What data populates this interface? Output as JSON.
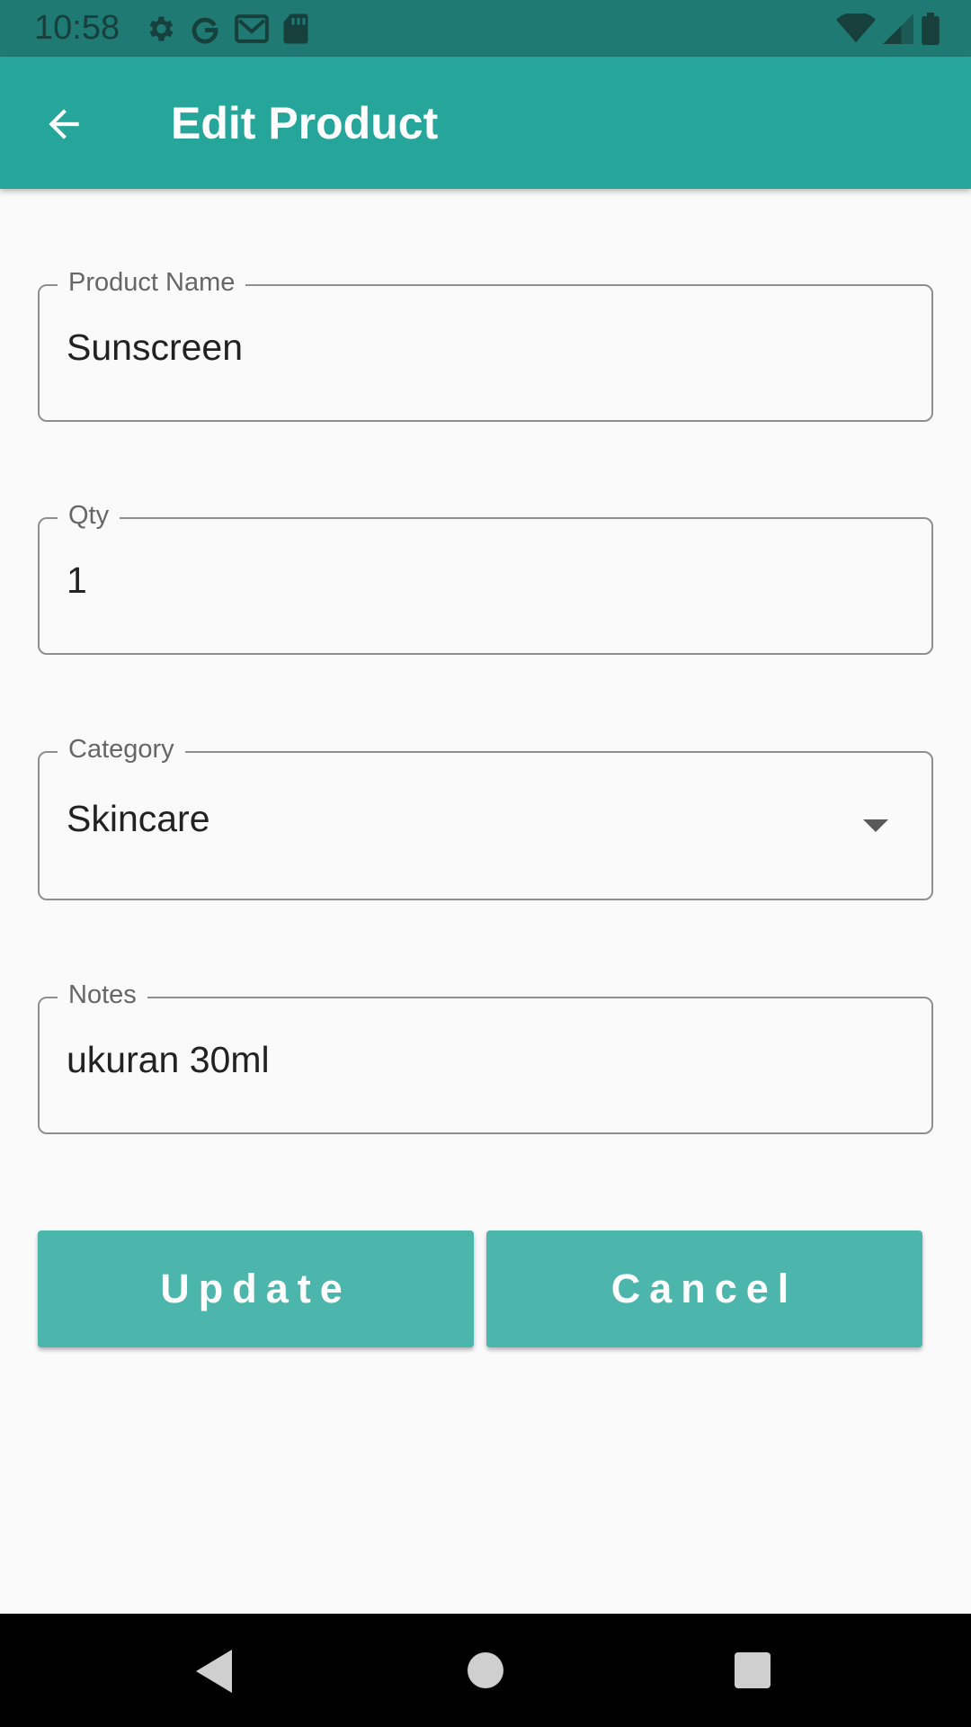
{
  "status_bar": {
    "time": "10:58",
    "left_icons": [
      "settings-icon",
      "google-icon",
      "gmail-icon",
      "sd-card-icon"
    ],
    "right_icons": [
      "wifi-icon",
      "signal-icon",
      "battery-icon"
    ]
  },
  "app_bar": {
    "title": "Edit Product",
    "back_icon": "arrow-back-icon",
    "color": "#26a69a"
  },
  "form": {
    "product_name": {
      "label": "Product Name",
      "value": "Sunscreen"
    },
    "qty": {
      "label": "Qty",
      "value": "1"
    },
    "category": {
      "label": "Category",
      "value": "Skincare"
    },
    "notes": {
      "label": "Notes",
      "value": "ukuran 30ml"
    }
  },
  "buttons": {
    "update_label": "Update",
    "cancel_label": "Cancel",
    "color": "#4db6ac"
  },
  "nav_bar": {
    "icons": [
      "nav-back-icon",
      "nav-home-icon",
      "nav-recents-icon"
    ]
  }
}
